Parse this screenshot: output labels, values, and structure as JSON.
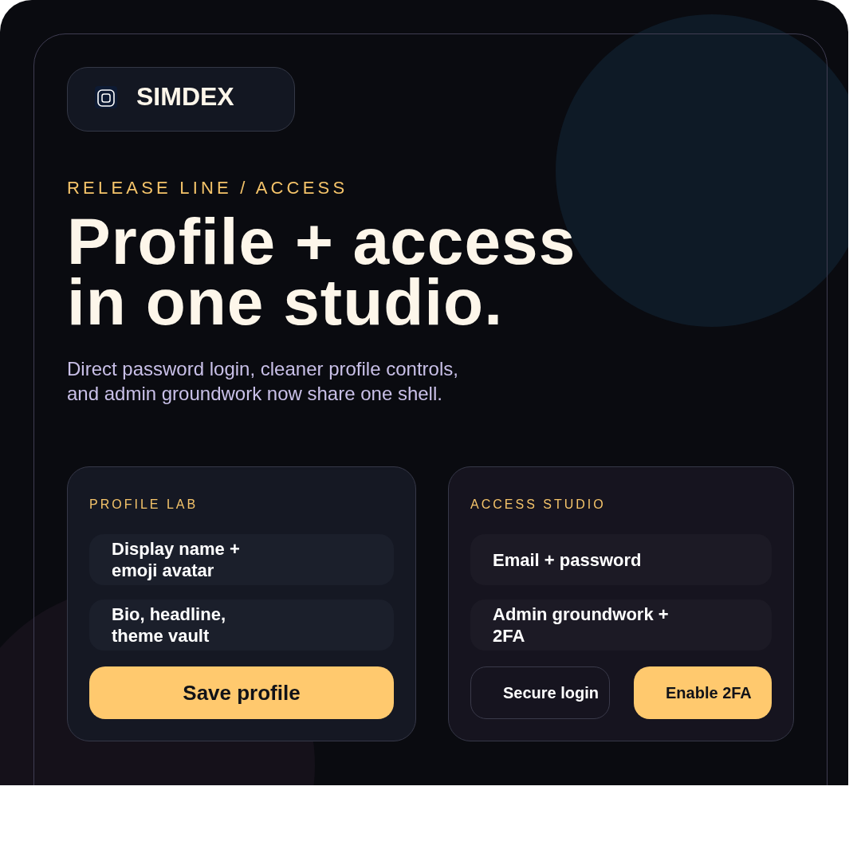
{
  "brand": {
    "name": "SIMDEX"
  },
  "eyebrow": "RELEASE LINE / ACCESS",
  "headline_lines": [
    "Profile + access",
    "in one studio."
  ],
  "subtitle_lines": [
    "Direct password login, cleaner profile controls,",
    "and admin groundwork now share one shell."
  ],
  "cards": [
    {
      "title": "PROFILE LAB",
      "items": [
        "Display name + emoji avatar",
        "Bio, headline, theme vault"
      ],
      "buttons": [
        {
          "label": "Save profile",
          "kind": "primary"
        }
      ]
    },
    {
      "title": "ACCESS STUDIO",
      "items": [
        "Email + password",
        "Admin groundwork + 2FA"
      ],
      "buttons": [
        {
          "label": "Secure login",
          "kind": "secondary"
        },
        {
          "label": "Enable 2FA",
          "kind": "primary"
        }
      ]
    }
  ]
}
